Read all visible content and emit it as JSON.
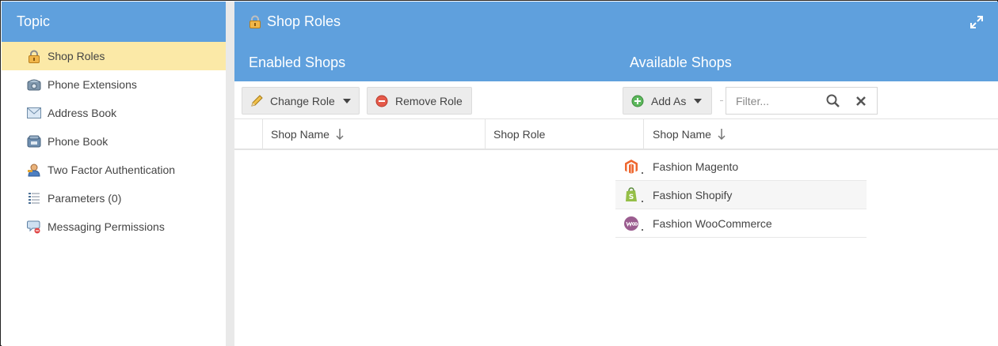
{
  "sidebar": {
    "title": "Topic",
    "items": [
      {
        "label": "Shop Roles",
        "icon": "lock-icon",
        "active": true
      },
      {
        "label": "Phone Extensions",
        "icon": "phone-extension-icon"
      },
      {
        "label": "Address Book",
        "icon": "envelope-icon"
      },
      {
        "label": "Phone Book",
        "icon": "phone-book-icon"
      },
      {
        "label": "Two Factor Authentication",
        "icon": "user-key-icon"
      },
      {
        "label": "Parameters (0)",
        "icon": "list-icon"
      },
      {
        "label": "Messaging Permissions",
        "icon": "message-block-icon"
      }
    ]
  },
  "main": {
    "title": "Shop Roles",
    "enabled_title": "Enabled Shops",
    "available_title": "Available Shops",
    "toolbar": {
      "change_role": "Change Role",
      "remove_role": "Remove Role",
      "add_as": "Add As",
      "filter_placeholder": "Filter..."
    },
    "columns": {
      "enabled_shop_name": "Shop Name",
      "enabled_shop_role": "Shop Role",
      "available_shop_name": "Shop Name"
    },
    "available_shops": [
      {
        "name": "Fashion Magento",
        "icon": "magento-icon"
      },
      {
        "name": "Fashion Shopify",
        "icon": "shopify-icon"
      },
      {
        "name": "Fashion WooCommerce",
        "icon": "woocommerce-icon"
      }
    ]
  },
  "colors": {
    "header_blue": "#5fa0dd",
    "active_row": "#fbe9a7"
  }
}
